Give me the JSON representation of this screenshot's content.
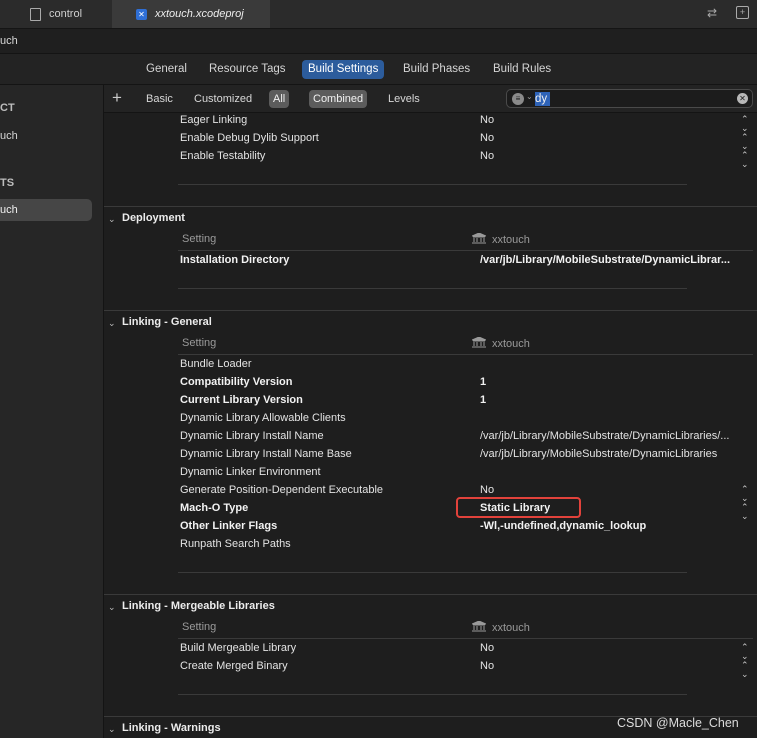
{
  "window_tabs": [
    {
      "label": "control",
      "icon": "document-icon"
    },
    {
      "label": "xxtouch.xcodeproj",
      "icon": "xcodeproj-icon"
    }
  ],
  "breadcrumb": "uch",
  "editor_tabs": [
    "General",
    "Resource Tags",
    "Build Settings",
    "Build Phases",
    "Build Rules"
  ],
  "sidebar": {
    "project_header": "CT",
    "project_item": "uch",
    "targets_header": "TS",
    "target_item": "uch"
  },
  "filter_bar": {
    "add_label": "+",
    "basic": "Basic",
    "customized": "Customized",
    "all": "All",
    "combined": "Combined",
    "levels": "Levels",
    "search_value": "dy"
  },
  "top_rows": [
    {
      "name": "Eager Linking",
      "value": "No"
    },
    {
      "name": "Enable Debug Dylib Support",
      "value": "No"
    },
    {
      "name": "Enable Testability",
      "value": "No"
    }
  ],
  "sections": {
    "deployment": {
      "title": "Deployment",
      "col_setting": "Setting",
      "col_target": "xxtouch",
      "rows": [
        {
          "name": "Installation Directory",
          "value": "/var/jb/Library/MobileSubstrate/DynamicLibrar..."
        }
      ]
    },
    "linking_general": {
      "title": "Linking - General",
      "col_setting": "Setting",
      "col_target": "xxtouch",
      "rows": [
        {
          "name": "Bundle Loader",
          "value": ""
        },
        {
          "name": "Compatibility Version",
          "value": "1"
        },
        {
          "name": "Current Library Version",
          "value": "1"
        },
        {
          "name": "Dynamic Library Allowable Clients",
          "value": ""
        },
        {
          "name": "Dynamic Library Install Name",
          "value": "/var/jb/Library/MobileSubstrate/DynamicLibraries/..."
        },
        {
          "name": "Dynamic Library Install Name Base",
          "value": "/var/jb/Library/MobileSubstrate/DynamicLibraries"
        },
        {
          "name": "Dynamic Linker Environment",
          "value": ""
        },
        {
          "name": "Generate Position-Dependent Executable",
          "value": "No"
        },
        {
          "name": "Mach-O Type",
          "value": "Static Library"
        },
        {
          "name": "Other Linker Flags",
          "value": "-Wl,-undefined,dynamic_lookup"
        },
        {
          "name": "Runpath Search Paths",
          "value": ""
        }
      ]
    },
    "linking_mergeable": {
      "title": "Linking - Mergeable Libraries",
      "col_setting": "Setting",
      "col_target": "xxtouch",
      "rows": [
        {
          "name": "Build Mergeable Library",
          "value": "No"
        },
        {
          "name": "Create Merged Binary",
          "value": "No"
        }
      ]
    },
    "linking_warnings": {
      "title": "Linking - Warnings"
    }
  },
  "highlight_color": "#e2423b",
  "watermark": "CSDN @Macle_Chen"
}
